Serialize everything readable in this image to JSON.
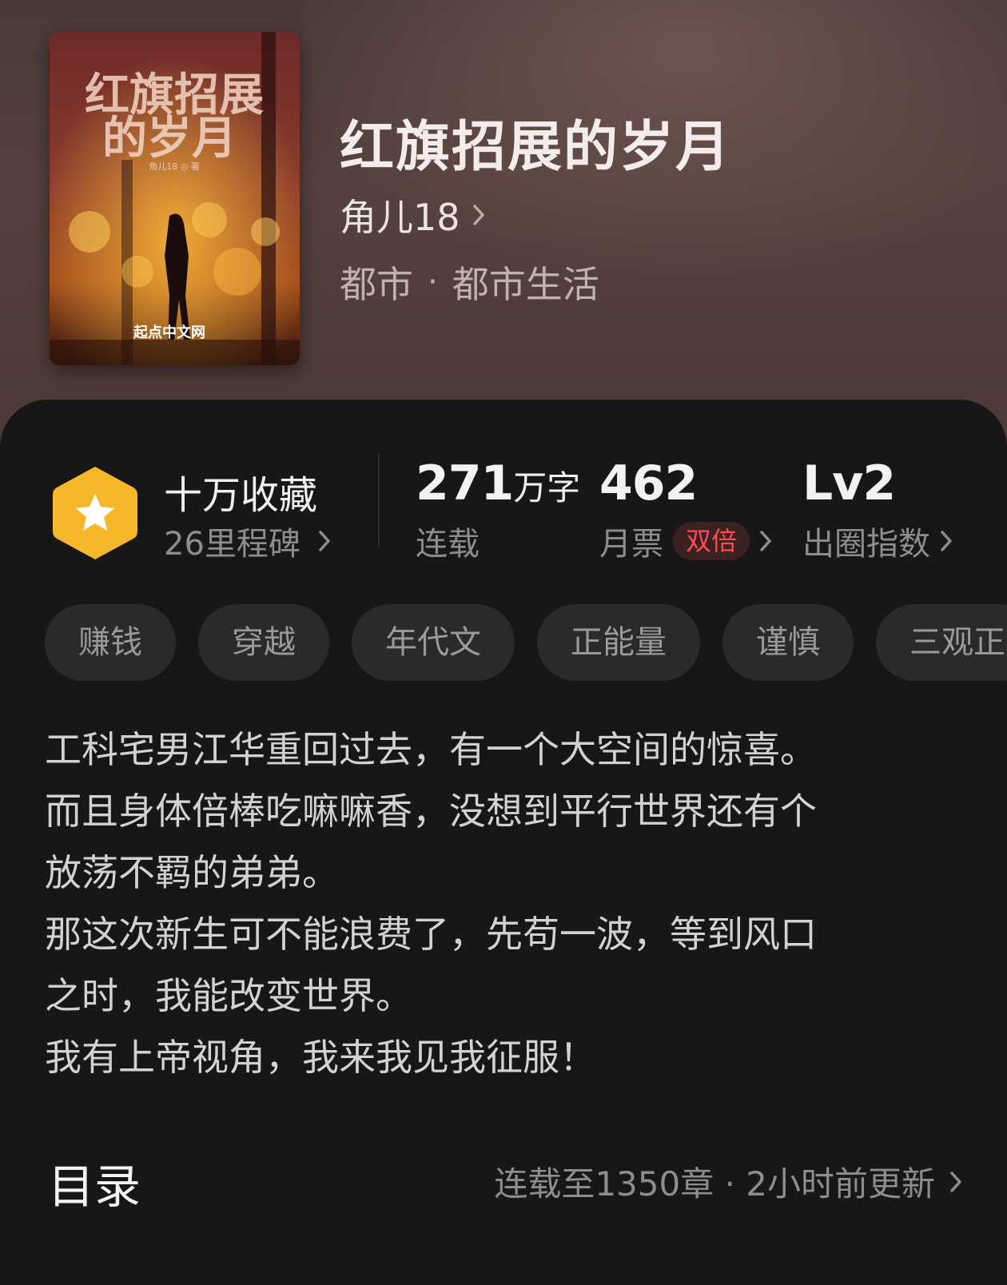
{
  "book": {
    "title": "红旗招展的岁月",
    "author": "角儿18",
    "category": "都市",
    "subcategory": "都市生活",
    "category_separator": "·",
    "cover": {
      "title_line1": "红旗招展",
      "title_line2": "的岁月",
      "author_line": "角儿18 ◎ 著",
      "publisher": "起点中文网"
    }
  },
  "stats": {
    "collect_main": "十万收藏",
    "collect_sub": "26里程碑",
    "words_value": "271",
    "words_unit": "万字",
    "words_label": "连载",
    "tickets_value": "462",
    "tickets_label": "月票",
    "tickets_badge": "双倍",
    "level_value": "Lv2",
    "level_label": "出圈指数"
  },
  "tags": [
    "赚钱",
    "穿越",
    "年代文",
    "正能量",
    "谨慎",
    "三观正"
  ],
  "description": [
    "工科宅男江华重回过去，有一个大空间的惊喜。",
    "而且身体倍棒吃嘛嘛香，没想到平行世界还有个",
    "放荡不羁的弟弟。",
    "那这次新生可不能浪费了，先苟一波，等到风口",
    "之时，我能改变世界。",
    "我有上帝视角，我来我见我征服！"
  ],
  "toc": {
    "title": "目录",
    "status": "连载至1350章 · 2小时前更新"
  },
  "colors": {
    "badge_gold": "#f6b72a",
    "double_red": "#ff4a52",
    "panel_bg": "#171717"
  }
}
